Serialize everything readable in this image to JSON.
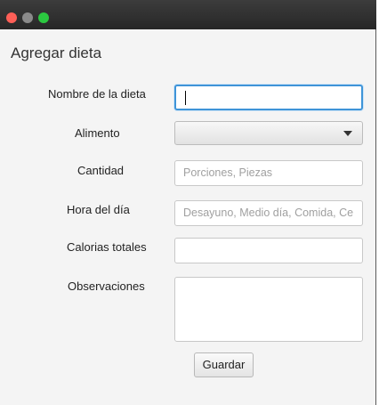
{
  "window": {
    "controls": [
      "close",
      "minimize",
      "maximize"
    ]
  },
  "form": {
    "title": "Agregar dieta",
    "fields": {
      "nombre": {
        "label": "Nombre de la dieta",
        "value": "",
        "placeholder": ""
      },
      "alimento": {
        "label": "Alimento",
        "selected": ""
      },
      "cantidad": {
        "label": "Cantidad",
        "value": "",
        "placeholder": "Porciones, Piezas"
      },
      "hora": {
        "label": "Hora del día",
        "value": "",
        "placeholder": "Desayuno, Medio día, Comida, Ce"
      },
      "calorias": {
        "label": "Calorias totales",
        "value": "",
        "placeholder": ""
      },
      "observaciones": {
        "label": "Observaciones",
        "value": ""
      }
    },
    "submit_label": "Guardar"
  },
  "colors": {
    "titlebar": "#2e2e2e",
    "close": "#fe5f57",
    "minimize": "#8a8a8a",
    "maximize": "#2bc840",
    "focus_ring": "#3f94d8"
  },
  "icons": [
    "dropdown-arrow-icon"
  ]
}
